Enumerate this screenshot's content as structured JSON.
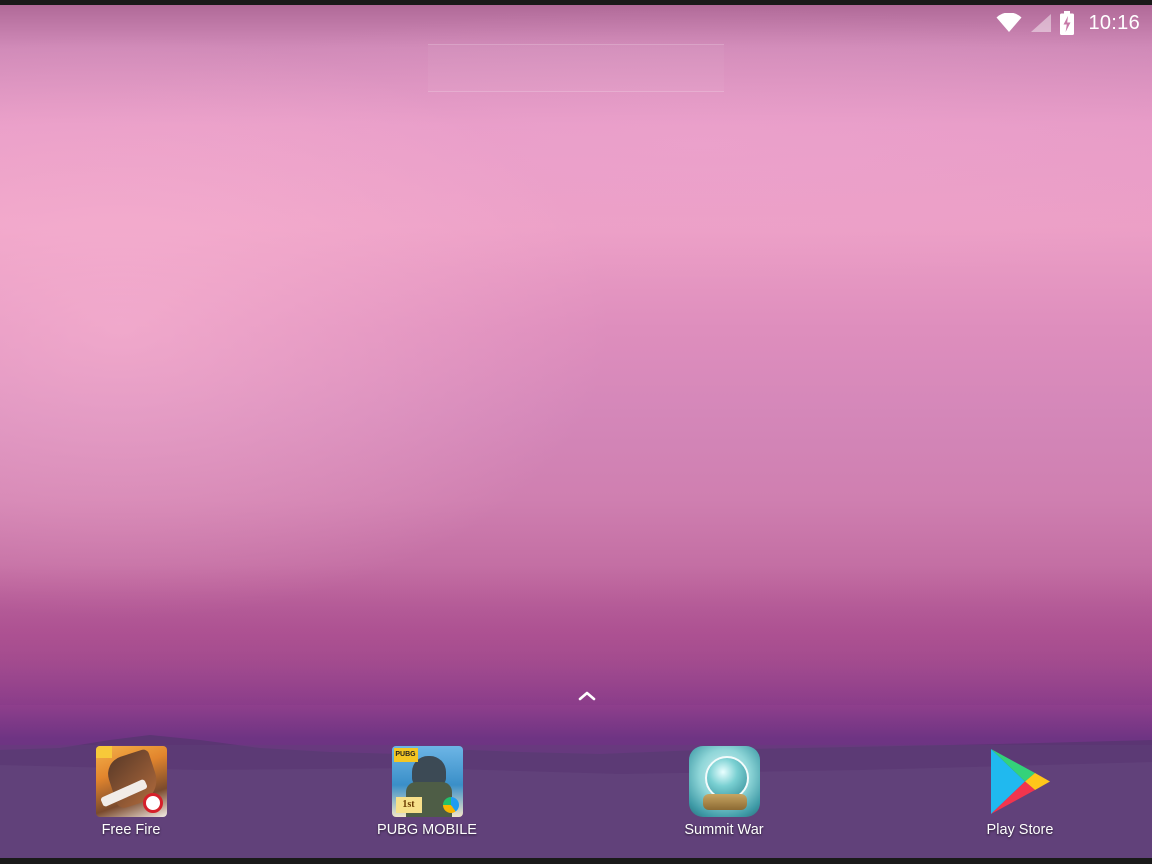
{
  "status_bar": {
    "time": "10:16",
    "icons": [
      "wifi-icon",
      "cell-signal-icon",
      "battery-charging-icon"
    ]
  },
  "search_widget": {
    "placeholder": ""
  },
  "drawer_handle": {
    "icon": "chevron-up-icon"
  },
  "dock": {
    "apps": [
      {
        "label": "Free Fire",
        "icon": "free-fire-icon"
      },
      {
        "label": "PUBG MOBILE",
        "icon": "pubg-mobile-icon",
        "badge_text": "PUBG",
        "corner_text": "1st"
      },
      {
        "label": "Summit War",
        "icon": "summit-war-icon"
      },
      {
        "label": "Play Store",
        "icon": "play-store-icon"
      }
    ]
  },
  "colors": {
    "wallpaper_top": "#e79bc7",
    "wallpaper_bottom": "#5d2e7a",
    "text": "#ffffff"
  }
}
